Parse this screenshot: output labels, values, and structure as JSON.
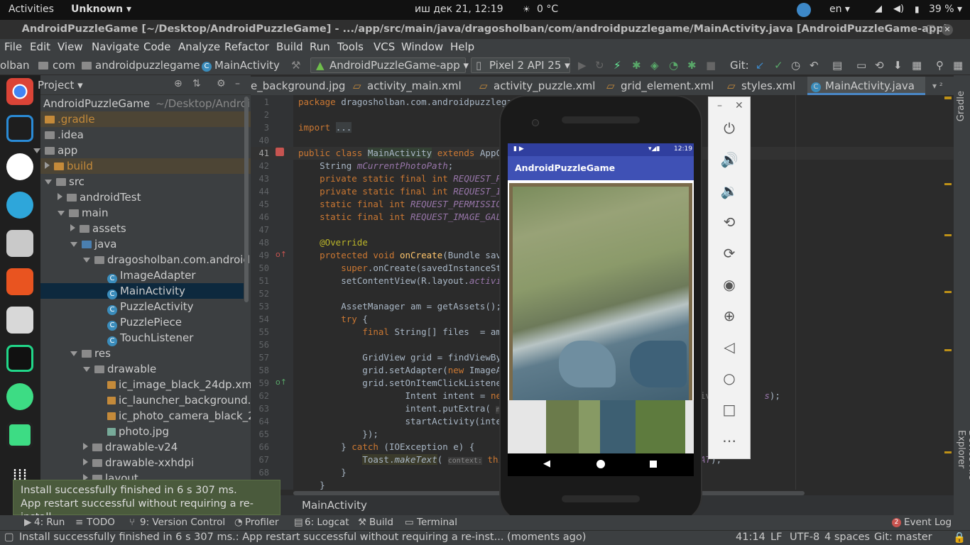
{
  "topbar": {
    "activities": "Activities",
    "app": "Unknown ▾",
    "clock": "иш дек 21, 12:19",
    "weather": "0 °C",
    "lang": "en ▾",
    "battery": "39 % ▾"
  },
  "window_title": "AndroidPuzzleGame [~/Desktop/AndroidPuzzleGame] - .../app/src/main/java/dragosholban/com/androidpuzzlegame/MainActivity.java [AndroidPuzzleGame-app]",
  "menu": [
    "File",
    "Edit",
    "View",
    "Navigate",
    "Code",
    "Analyze",
    "Refactor",
    "Build",
    "Run",
    "Tools",
    "VCS",
    "Window",
    "Help"
  ],
  "breadcrumb": {
    "a": "olban",
    "b": "com",
    "c": "androidpuzzlegame",
    "d": "MainActivity"
  },
  "run_config": "AndroidPuzzleGame-app ▾",
  "device": "Pixel 2 API 25 ▾",
  "git_label": "Git:",
  "project": {
    "header": "Project ▾",
    "root": "AndroidPuzzleGame",
    "root_path": "~/Desktop/AndroidP"
  },
  "tree": [
    "AndroidPuzzleGame",
    ".gradle",
    ".idea",
    "app",
    "build",
    "src",
    "androidTest",
    "main",
    "assets",
    "java",
    "dragosholban.com.androidpu",
    "ImageAdapter",
    "MainActivity",
    "PuzzleActivity",
    "PuzzlePiece",
    "TouchListener",
    "res",
    "drawable",
    "ic_image_black_24dp.xml",
    "ic_launcher_background.x",
    "ic_photo_camera_black_24",
    "photo.jpg",
    "drawable-v24",
    "drawable-xxhdpi",
    "layout"
  ],
  "tabs": [
    "e_background.jpg",
    "activity_main.xml",
    "activity_puzzle.xml",
    "grid_element.xml",
    "styles.xml",
    "MainActivity.java"
  ],
  "tabs_more": "▾ ²",
  "line_numbers": [
    "1",
    "2",
    "3",
    "40",
    "41",
    "42",
    "43",
    "44",
    "45",
    "46",
    "47",
    "48",
    "49",
    "50",
    "51",
    "52",
    "53",
    "54",
    "55",
    "56",
    "57",
    "58",
    "59",
    "62",
    "63",
    "64",
    "65",
    "66",
    "67",
    "68",
    "69"
  ],
  "code": {
    "l1": "package dragosholban.com.androidpuzzlegame;",
    "l3": "import ...",
    "l41": "public class MainActivity extends AppComp",
    "l42": "    String mCurrentPhotoPath;",
    "l43": "    private static final int REQUEST_PERM",
    "l44": "    private static final int REQUEST_IMAG",
    "l45": "    static final int REQUEST_PERMISSION_R",
    "l46": "    static final int REQUEST_IMAGE_GALLER",
    "l48": "    @Override",
    "l49": "    protected void onCreate(Bundle savedI",
    "l50": "        super.onCreate(savedInstanceState",
    "l51": "        setContentView(R.layout.activity_",
    "l53": "        AssetManager am = getAssets();",
    "l54": "        try {",
    "l55": "            final String[] files  = am.li",
    "l57": "            GridView grid = findViewById(",
    "l58": "            grid.setAdapter(new ImageAdap",
    "l59": "            grid.setOnItemClickListener(",
    "l62": "                    Intent intent = new I",
    "l62b": "s);",
    "l62c": "iv",
    "l63": "                    intent.putExtra(",
    "l63hint": "name",
    "l64": "                    startActivity(intent",
    "l65": "            });",
    "l66": "        } catch (IOException e) {",
    "l67": "            Toast.makeText(",
    "l67hint": "context:",
    "l67b": " this,",
    "l67c": "AT);",
    "l68": "        }",
    "l69": "    }"
  },
  "editor_breadcrumb": "MainActivity",
  "phone": {
    "app_title": "AndroidPuzzleGame",
    "status_time": "12:19"
  },
  "toast": {
    "line1": "Install successfully finished in 6 s 307 ms.",
    "line2": "App restart successful without requiring a re-install."
  },
  "toolstrip": {
    "run": "4: Run",
    "todo": "TODO",
    "vc": "9: Version Control",
    "profiler": "Profiler",
    "logcat": "6: Logcat",
    "build": "Build",
    "terminal": "Terminal",
    "eventlog": "Event Log",
    "eventcount": "2"
  },
  "statusbar": {
    "msg": "Install successfully finished in 6 s 307 ms.: App restart successful without requiring a re-inst... (moments ago)",
    "pos": "41:14",
    "lf": "LF",
    "enc": "UTF-8",
    "indent": "4 spaces",
    "git": "Git: master"
  },
  "right_tools": {
    "gradle": "Gradle",
    "device": "Device File Explorer"
  },
  "colors": {
    "accent": "#3f51b5",
    "selection": "#0d293e",
    "toast": "#4a5a3c"
  }
}
